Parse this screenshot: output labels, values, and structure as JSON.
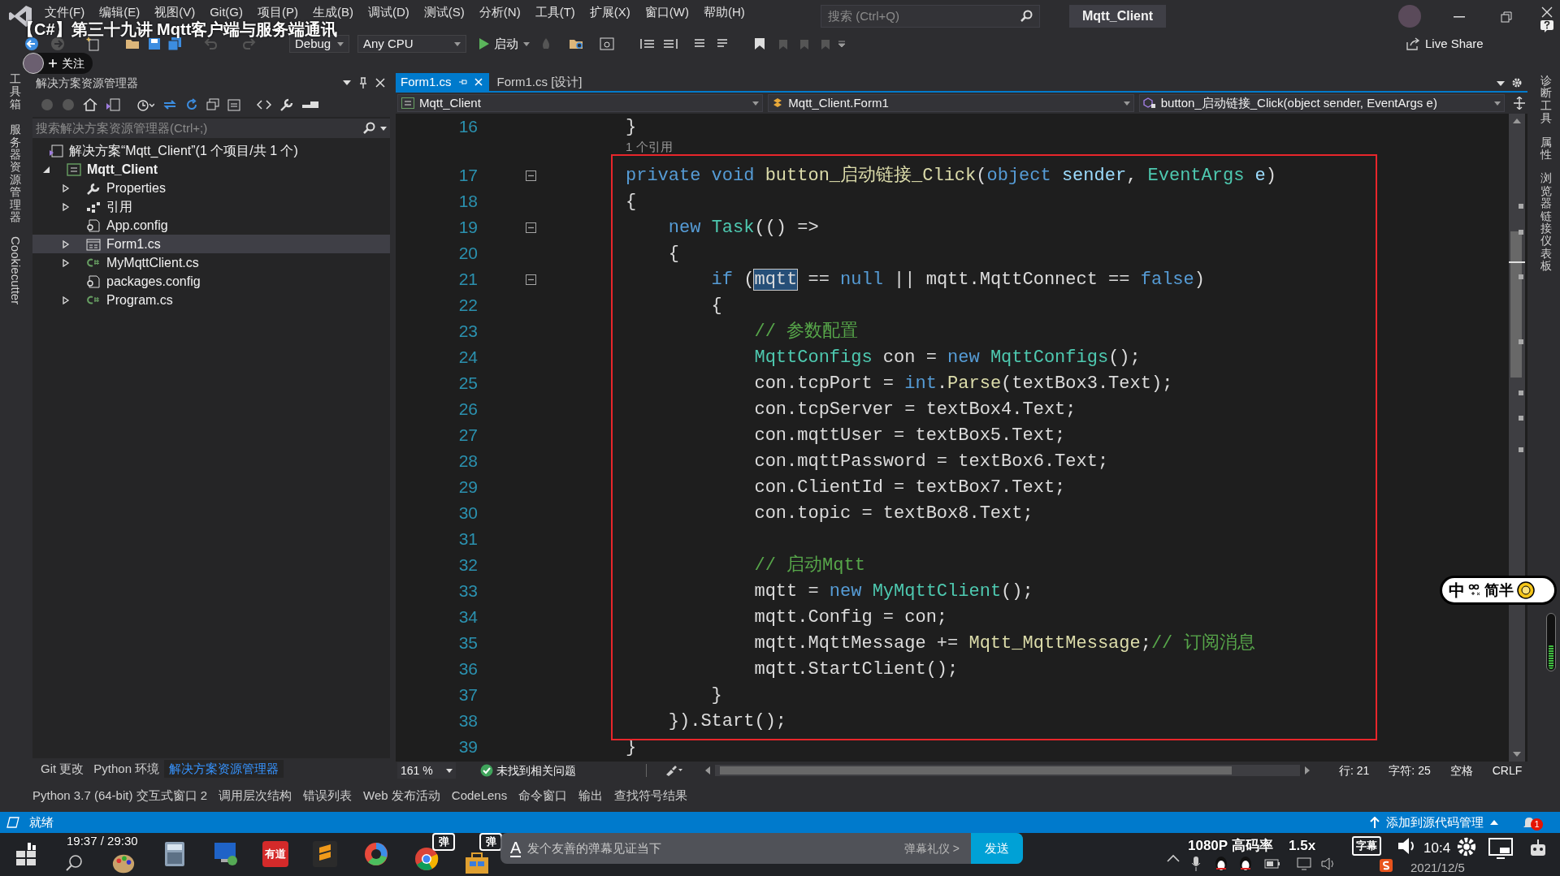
{
  "video_overlay": {
    "title": "【C#】第三十九讲 Mqtt客户端与服务端通讯",
    "follow_label": "关注",
    "time": "19:37 / 29:30",
    "danmaku_toggles": [
      "弹",
      "弹"
    ],
    "danmaku_style": "A",
    "danmaku_placeholder": "发个友善的弹幕见证当下",
    "etiquette_link": "弹幕礼仪 >",
    "send_button": "发送",
    "quality": "1080P 高码率",
    "speed": "1.5x",
    "subtitle_button": "字幕"
  },
  "menu": [
    "文件(F)",
    "编辑(E)",
    "视图(V)",
    "Git(G)",
    "项目(P)",
    "生成(B)",
    "调试(D)",
    "测试(S)",
    "分析(N)",
    "工具(T)",
    "扩展(X)",
    "窗口(W)",
    "帮助(H)"
  ],
  "search": {
    "placeholder": "搜索 (Ctrl+Q)"
  },
  "solution_name": "Mqtt_Client",
  "toolbar": {
    "configuration": "Debug",
    "platform": "Any CPU",
    "start_button": "启动",
    "live_share": "Live Share"
  },
  "left_side_tabs": [
    {
      "label": "工具箱",
      "kind": "cjk"
    },
    {
      "label": "服务器资源管理器",
      "kind": "cjk"
    },
    {
      "label": "Cookiecutter",
      "kind": "latin"
    }
  ],
  "solution_explorer": {
    "title": "解决方案资源管理器",
    "search_placeholder": "搜索解决方案资源管理器(Ctrl+;)",
    "tree": [
      {
        "label": "解决方案“Mqtt_Client”(1 个项目/共 1 个)",
        "kind": "solution",
        "selected": false,
        "children": [
          {
            "label": "Mqtt_Client",
            "kind": "project",
            "expanded": true,
            "selected": false,
            "children": [
              {
                "label": "Properties",
                "kind": "wrench",
                "expanded": false,
                "selected": false
              },
              {
                "label": "引用",
                "kind": "references",
                "expanded": false,
                "selected": false
              },
              {
                "label": "App.config",
                "kind": "config",
                "selected": false
              },
              {
                "label": "Form1.cs",
                "kind": "form",
                "expanded": false,
                "selected": true
              },
              {
                "label": "MyMqttClient.cs",
                "kind": "csharp",
                "expanded": false,
                "selected": false
              },
              {
                "label": "packages.config",
                "kind": "config",
                "selected": false
              },
              {
                "label": "Program.cs",
                "kind": "csharp",
                "expanded": false,
                "selected": false
              }
            ]
          }
        ]
      }
    ],
    "bottom_tabs": [
      {
        "label": "Git 更改",
        "selected": false
      },
      {
        "label": "Python 环境",
        "selected": false
      },
      {
        "label": "解决方案资源管理器",
        "selected": true
      }
    ]
  },
  "editor": {
    "tabs": [
      {
        "label": "Form1.cs",
        "selected": true
      },
      {
        "label": "Form1.cs [设计]",
        "selected": false
      }
    ],
    "nav": {
      "project": "Mqtt_Client",
      "class": "Mqtt_Client.Form1",
      "member": "button_启动链接_Click(object sender, EventArgs e)"
    },
    "lines": [
      {
        "kind": "code",
        "number": "16",
        "fold": false,
        "tokens": [
          {
            "text": "}",
            "kind": "plain"
          }
        ]
      },
      {
        "kind": "codelens",
        "text": "1 个引用"
      },
      {
        "kind": "code",
        "number": "17",
        "fold": true,
        "tokens": [
          {
            "text": "private void ",
            "kind": "keyword"
          },
          {
            "text": "button_启动链接_Click",
            "kind": "method"
          },
          {
            "text": "(",
            "kind": "plain"
          },
          {
            "text": "object",
            "kind": "keyword"
          },
          {
            "text": " sender",
            "kind": "param"
          },
          {
            "text": ", ",
            "kind": "plain"
          },
          {
            "text": "EventArgs",
            "kind": "type"
          },
          {
            "text": " e",
            "kind": "param"
          },
          {
            "text": ")",
            "kind": "plain"
          }
        ]
      },
      {
        "kind": "code",
        "number": "18",
        "fold": false,
        "tokens": [
          {
            "text": "{",
            "kind": "plain"
          }
        ]
      },
      {
        "kind": "code",
        "number": "19",
        "fold": true,
        "tokens": [
          {
            "text": "    new ",
            "kind": "keyword"
          },
          {
            "text": "Task",
            "kind": "type"
          },
          {
            "text": "(() =>",
            "kind": "plain"
          }
        ]
      },
      {
        "kind": "code",
        "number": "20",
        "fold": false,
        "tokens": [
          {
            "text": "    {",
            "kind": "plain"
          }
        ]
      },
      {
        "kind": "code",
        "number": "21",
        "fold": true,
        "tokens": [
          {
            "text": "        if",
            "kind": "keyword"
          },
          {
            "text": " (",
            "kind": "plain"
          },
          {
            "text": "mqtt",
            "kind": "selected"
          },
          {
            "text": " == ",
            "kind": "plain"
          },
          {
            "text": "null",
            "kind": "keyword"
          },
          {
            "text": " || mqtt.MqttConnect == ",
            "kind": "plain"
          },
          {
            "text": "false",
            "kind": "keyword"
          },
          {
            "text": ")",
            "kind": "plain"
          }
        ]
      },
      {
        "kind": "code",
        "number": "22",
        "fold": false,
        "tokens": [
          {
            "text": "        {",
            "kind": "plain"
          }
        ]
      },
      {
        "kind": "code",
        "number": "23",
        "fold": false,
        "tokens": [
          {
            "text": "            // 参数配置",
            "kind": "comment"
          }
        ]
      },
      {
        "kind": "code",
        "number": "24",
        "fold": false,
        "tokens": [
          {
            "text": "            MqttConfigs",
            "kind": "type"
          },
          {
            "text": " con = ",
            "kind": "plain"
          },
          {
            "text": "new",
            "kind": "keyword"
          },
          {
            "text": " MqttConfigs",
            "kind": "type"
          },
          {
            "text": "();",
            "kind": "plain"
          }
        ]
      },
      {
        "kind": "code",
        "number": "25",
        "fold": false,
        "tokens": [
          {
            "text": "            con.tcpPort = ",
            "kind": "plain"
          },
          {
            "text": "int",
            "kind": "keyword"
          },
          {
            "text": ".",
            "kind": "plain"
          },
          {
            "text": "Parse",
            "kind": "method"
          },
          {
            "text": "(textBox3.Text);",
            "kind": "plain"
          }
        ]
      },
      {
        "kind": "code",
        "number": "26",
        "fold": false,
        "tokens": [
          {
            "text": "            con.tcpServer = textBox4.Text;",
            "kind": "plain"
          }
        ]
      },
      {
        "kind": "code",
        "number": "27",
        "fold": false,
        "tokens": [
          {
            "text": "            con.mqttUser = textBox5.Text;",
            "kind": "plain"
          }
        ]
      },
      {
        "kind": "code",
        "number": "28",
        "fold": false,
        "tokens": [
          {
            "text": "            con.mqttPassword = textBox6.Text;",
            "kind": "plain"
          }
        ]
      },
      {
        "kind": "code",
        "number": "29",
        "fold": false,
        "tokens": [
          {
            "text": "            con.ClientId = textBox7.Text;",
            "kind": "plain"
          }
        ]
      },
      {
        "kind": "code",
        "number": "30",
        "fold": false,
        "tokens": [
          {
            "text": "            con.topic = textBox8.Text;",
            "kind": "plain"
          }
        ]
      },
      {
        "kind": "code",
        "number": "31",
        "fold": false
      },
      {
        "kind": "code",
        "number": "32",
        "fold": false,
        "tokens": [
          {
            "text": "            // 启动Mqtt",
            "kind": "comment"
          }
        ]
      },
      {
        "kind": "code",
        "number": "33",
        "fold": false,
        "tokens": [
          {
            "text": "            mqtt = ",
            "kind": "plain"
          },
          {
            "text": "new",
            "kind": "keyword"
          },
          {
            "text": " MyMqttClient",
            "kind": "type"
          },
          {
            "text": "();",
            "kind": "plain"
          }
        ]
      },
      {
        "kind": "code",
        "number": "34",
        "fold": false,
        "tokens": [
          {
            "text": "            mqtt.Config = con;",
            "kind": "plain"
          }
        ]
      },
      {
        "kind": "code",
        "number": "35",
        "fold": false,
        "tokens": [
          {
            "text": "            mqtt.MqttMessage += ",
            "kind": "plain"
          },
          {
            "text": "Mqtt_MqttMessage",
            "kind": "method"
          },
          {
            "text": ";",
            "kind": "plain"
          },
          {
            "text": "// 订阅消息",
            "kind": "comment"
          }
        ]
      },
      {
        "kind": "code",
        "number": "36",
        "fold": false,
        "tokens": [
          {
            "text": "            mqtt.StartClient();",
            "kind": "plain"
          }
        ]
      },
      {
        "kind": "code",
        "number": "37",
        "fold": false,
        "tokens": [
          {
            "text": "        }",
            "kind": "plain"
          }
        ]
      },
      {
        "kind": "code",
        "number": "38",
        "fold": false,
        "tokens": [
          {
            "text": "    }).Start();",
            "kind": "plain"
          }
        ]
      },
      {
        "kind": "code",
        "number": "39",
        "fold": false,
        "tokens": [
          {
            "text": "}",
            "kind": "plain"
          }
        ]
      }
    ],
    "status": {
      "zoom": "161 %",
      "issues": "未找到相关问题",
      "line": "行: 21",
      "char": "字符: 25",
      "spacing": "空格",
      "line_ending": "CRLF"
    }
  },
  "right_side_tabs": [
    "诊断工具",
    "属性",
    "浏览器链接仪表板"
  ],
  "ime": {
    "mode": "中",
    "labels": "简半"
  },
  "volume_meter": {
    "level": 0.45
  },
  "tool_tabs": [
    "Python 3.7 (64-bit) 交互式窗口 2",
    "调用层次结构",
    "错误列表",
    "Web 发布活动",
    "CodeLens",
    "命令窗口",
    "输出",
    "查找符号结果"
  ],
  "status_bar": {
    "text": "就绪",
    "source_control": "添加到源代码管理",
    "notifications": "1"
  },
  "taskbar": {
    "app_label": "有道",
    "clock": "10:4",
    "date": "2021/12/5"
  }
}
